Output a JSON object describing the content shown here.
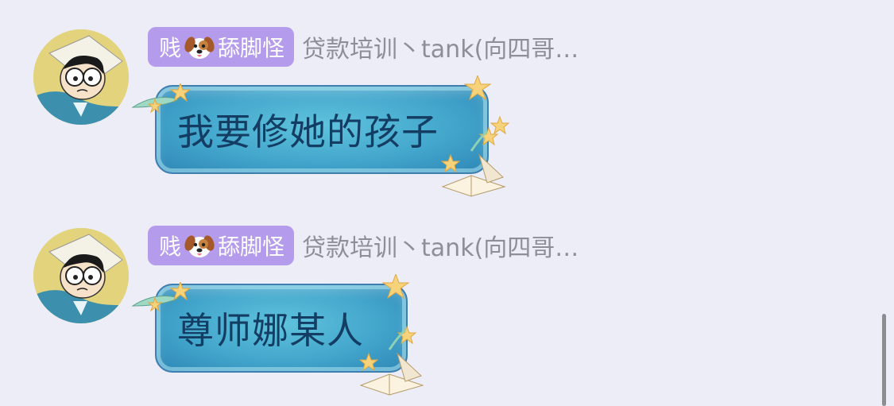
{
  "messages": [
    {
      "sender": {
        "title_prefix": "贱",
        "title_icon": "dog-face-icon",
        "title_suffix": "舔脚怪",
        "name": "贷款培训丶tank(向四哥…"
      },
      "text": "我要修她的孩子"
    },
    {
      "sender": {
        "title_prefix": "贱",
        "title_icon": "dog-face-icon",
        "title_suffix": "舔脚怪",
        "name": "贷款培训丶tank(向四哥…"
      },
      "text": "尊师娜某人"
    }
  ],
  "colors": {
    "background": "#ECEDF6",
    "badge": "#B59BEB",
    "bubble": "#43A6CC",
    "bubble_text": "#143D63",
    "sender_name": "#8E8E98"
  }
}
